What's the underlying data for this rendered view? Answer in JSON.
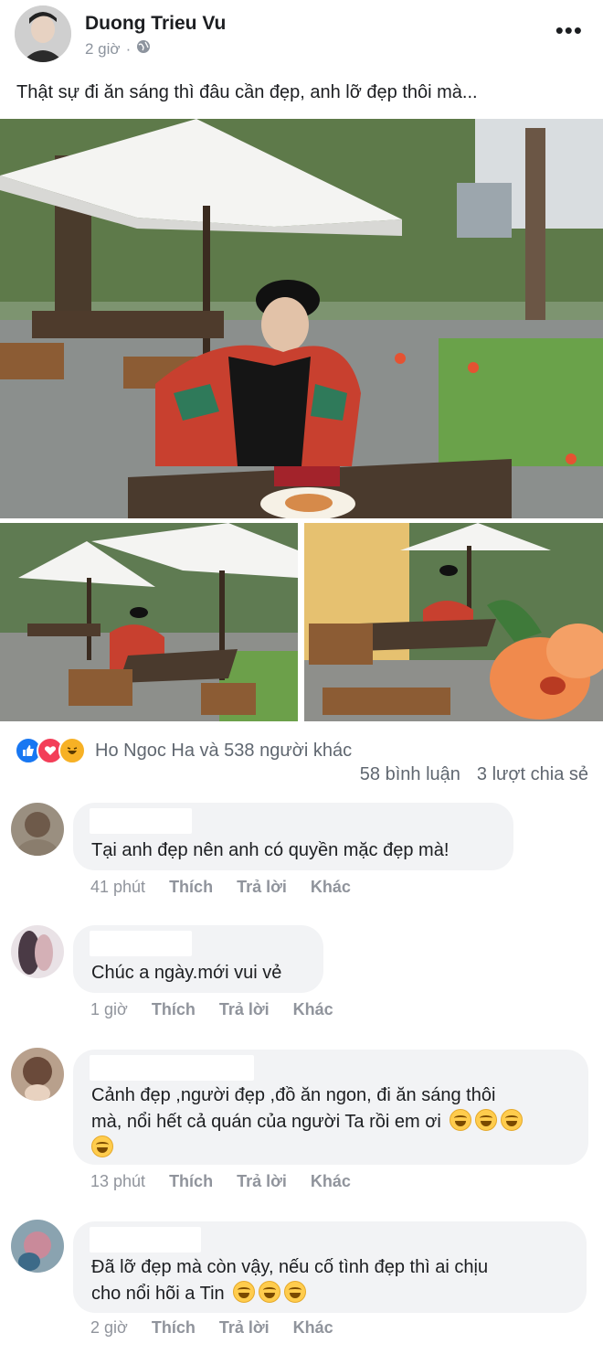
{
  "post": {
    "author": "Duong Trieu Vu",
    "time": "2 giờ",
    "separator": "·",
    "privacy_icon": "globe-icon",
    "more_icon": "ellipsis-icon",
    "more_label": "•••",
    "caption": "Thật sự đi ăn sáng thì đâu cần đẹp, anh lỡ đẹp thôi mà..."
  },
  "reactions": {
    "icons": [
      "like-icon",
      "love-icon",
      "haha-icon"
    ],
    "summary": "Ho Ngoc Ha và 538 người khác",
    "comments": "58 bình luận",
    "shares": "3 lượt chia sẻ"
  },
  "comments": [
    {
      "text": "Tại anh đẹp nên anh có quyền mặc đẹp mà!",
      "time": "41 phút",
      "like": "Thích",
      "reply": "Trả lời",
      "other": "Khác"
    },
    {
      "text": "Chúc a ngày.mới vui vẻ",
      "time": "1 giờ",
      "like": "Thích",
      "reply": "Trả lời",
      "other": "Khác"
    },
    {
      "text_line1": "Cảnh đẹp ,người đẹp ,đồ ăn ngon, đi ăn sáng thôi",
      "text_line2": "mà, nổi hết cả quán của người Ta rồi em ơi",
      "emoji": "😅",
      "time": "13 phút",
      "like": "Thích",
      "reply": "Trả lời",
      "other": "Khác"
    },
    {
      "text_line1": "Đã lỡ đẹp mà còn vậy, nếu cố tình đẹp thì ai chịu",
      "text_line2": "cho nổi hõi a Tin",
      "emoji": "😊",
      "time": "2 giờ",
      "like": "Thích",
      "reply": "Trả lời",
      "other": "Khác"
    }
  ],
  "colors": {
    "like_blue": "#1877f2",
    "love_red": "#f33e58",
    "haha_yellow": "#f7b125",
    "meta_gray": "#90949c"
  }
}
